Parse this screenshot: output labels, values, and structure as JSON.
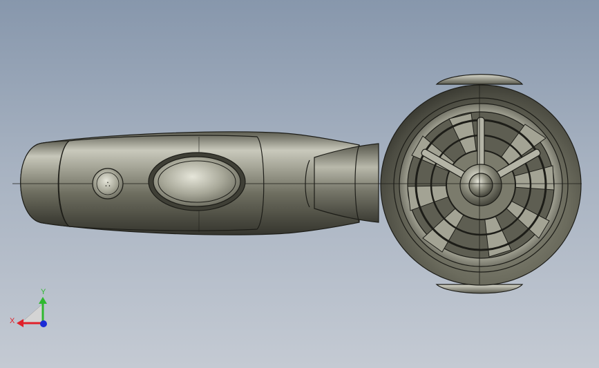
{
  "viewport": {
    "background_top": "#8797ac",
    "background_bottom": "#c4cad3"
  },
  "model": {
    "body_color": "#7f7f6f",
    "edge_color": "#1d1d18",
    "highlight_color": "#d6d6c8",
    "control_button_symbol": "∴"
  },
  "triad": {
    "x_label": "X",
    "y_label": "Y",
    "x_color": "#e0202a",
    "y_color": "#2fb82f",
    "z_color": "#1a2bd6"
  }
}
